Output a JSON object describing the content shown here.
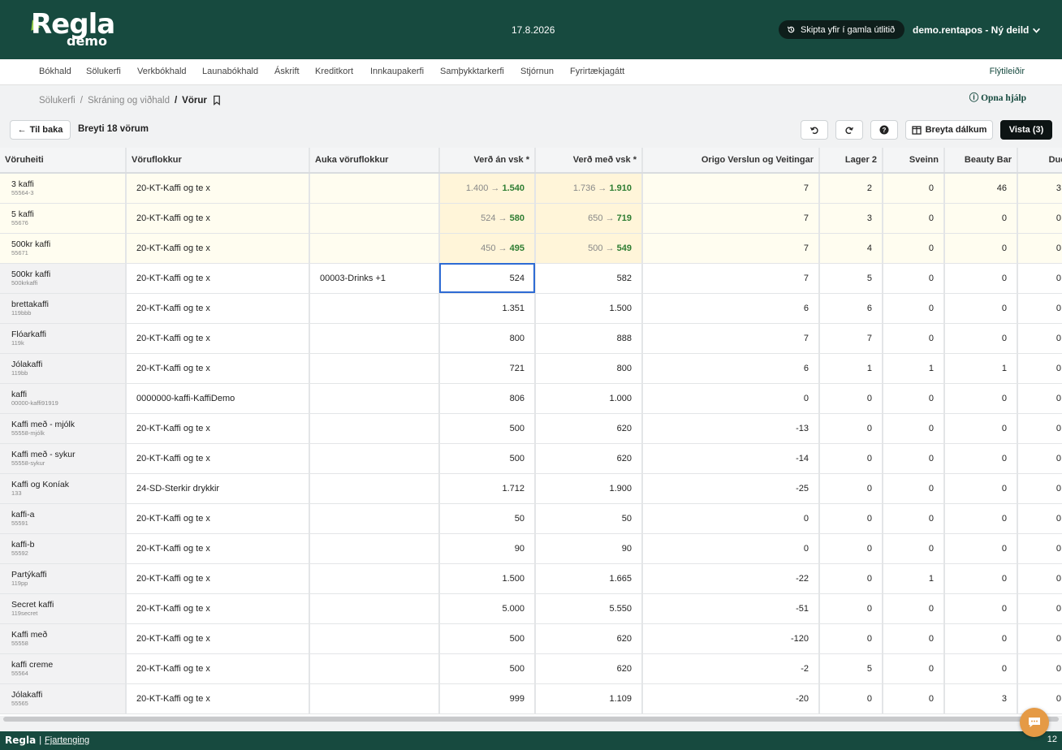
{
  "brand": {
    "logo": "Regla",
    "sub": "demo"
  },
  "header": {
    "date": "17.8.2026",
    "old_ui_label": "Skipta yfir í gamla útlitið",
    "user": "demo.rentapos - Ný deild"
  },
  "nav": {
    "items": [
      "Bókhald",
      "Sölukerfi",
      "Verkbókhald",
      "Launabókhald",
      "Áskrift",
      "Kreditkort",
      "Innkaupakerfi",
      "Samþykktarkerfi",
      "Stjórnun",
      "Fyrirtækjagátt"
    ],
    "shortcuts": "Flýtileiðir"
  },
  "breadcrumb": {
    "items": [
      "Sölukerfi",
      "Skráning og viðhald",
      "Vörur"
    ],
    "separator": "/",
    "help": "Opna hjálp"
  },
  "toolbar": {
    "back": "Til baka",
    "title": "Breyti 18 vörum",
    "columns": "Breyta dálkum",
    "save": "Vista (3)"
  },
  "table": {
    "headers": [
      "Vöruheiti",
      "Vöruflokkur",
      "Auka vöruflokkur",
      "Verð án vsk *",
      "Verð með vsk *",
      "Origo Verslun og Veitingar",
      "Lager 2",
      "Sveinn",
      "Beauty Bar",
      "Duo"
    ],
    "rows": [
      {
        "name": "3 kaffi",
        "sku": "55564-3",
        "cat": "20-KT-Kaffi og te x",
        "extra": "",
        "price_old": "1.400",
        "price_new": "1.540",
        "vat_old": "1.736",
        "vat_new": "1.910",
        "changed": true,
        "origo": "7",
        "lager2": "2",
        "sveinn": "0",
        "beauty": "46",
        "duo": "3"
      },
      {
        "name": "5 kaffi",
        "sku": "55676",
        "cat": "20-KT-Kaffi og te x",
        "extra": "",
        "price_old": "524",
        "price_new": "580",
        "vat_old": "650",
        "vat_new": "719",
        "changed": true,
        "origo": "7",
        "lager2": "3",
        "sveinn": "0",
        "beauty": "0",
        "duo": "0"
      },
      {
        "name": "500kr kaffi",
        "sku": "55671",
        "cat": "20-KT-Kaffi og te x",
        "extra": "",
        "price_old": "450",
        "price_new": "495",
        "vat_old": "500",
        "vat_new": "549",
        "changed": true,
        "origo": "7",
        "lager2": "4",
        "sveinn": "0",
        "beauty": "0",
        "duo": "0"
      },
      {
        "name": "500kr kaffi",
        "sku": "500krkaffi",
        "cat": "20-KT-Kaffi og te x",
        "extra": "00003-Drinks +1",
        "price": "524",
        "vat": "582",
        "origo": "7",
        "lager2": "5",
        "sveinn": "0",
        "beauty": "0",
        "duo": "0"
      },
      {
        "name": "brettakaffi",
        "sku": "119bbb",
        "cat": "20-KT-Kaffi og te x",
        "extra": "",
        "price": "1.351",
        "vat": "1.500",
        "origo": "6",
        "lager2": "6",
        "sveinn": "0",
        "beauty": "0",
        "duo": "0"
      },
      {
        "name": "Flóarkaffi",
        "sku": "119k",
        "cat": "20-KT-Kaffi og te x",
        "extra": "",
        "price": "800",
        "vat": "888",
        "origo": "7",
        "lager2": "7",
        "sveinn": "0",
        "beauty": "0",
        "duo": "0"
      },
      {
        "name": "Jólakaffi",
        "sku": "119bb",
        "cat": "20-KT-Kaffi og te x",
        "extra": "",
        "price": "721",
        "vat": "800",
        "origo": "6",
        "lager2": "1",
        "sveinn": "1",
        "beauty": "1",
        "duo": "0"
      },
      {
        "name": "kaffi",
        "sku": "00000-kaffi91919",
        "cat": "0000000-kaffi-KaffiDemo",
        "extra": "",
        "price": "806",
        "vat": "1.000",
        "origo": "0",
        "lager2": "0",
        "sveinn": "0",
        "beauty": "0",
        "duo": "0"
      },
      {
        "name": "Kaffi með - mjólk",
        "sku": "55558-mjólk",
        "cat": "20-KT-Kaffi og te x",
        "extra": "",
        "price": "500",
        "vat": "620",
        "origo": "-13",
        "lager2": "0",
        "sveinn": "0",
        "beauty": "0",
        "duo": "0"
      },
      {
        "name": "Kaffi með - sykur",
        "sku": "55558-sykur",
        "cat": "20-KT-Kaffi og te x",
        "extra": "",
        "price": "500",
        "vat": "620",
        "origo": "-14",
        "lager2": "0",
        "sveinn": "0",
        "beauty": "0",
        "duo": "0"
      },
      {
        "name": "Kaffi og Koníak",
        "sku": "133",
        "cat": "24-SD-Sterkir drykkir",
        "extra": "",
        "price": "1.712",
        "vat": "1.900",
        "origo": "-25",
        "lager2": "0",
        "sveinn": "0",
        "beauty": "0",
        "duo": "0"
      },
      {
        "name": "kaffi-a",
        "sku": "55591",
        "cat": "20-KT-Kaffi og te x",
        "extra": "",
        "price": "50",
        "vat": "50",
        "origo": "0",
        "lager2": "0",
        "sveinn": "0",
        "beauty": "0",
        "duo": "0"
      },
      {
        "name": "kaffi-b",
        "sku": "55592",
        "cat": "20-KT-Kaffi og te x",
        "extra": "",
        "price": "90",
        "vat": "90",
        "origo": "0",
        "lager2": "0",
        "sveinn": "0",
        "beauty": "0",
        "duo": "0"
      },
      {
        "name": "Partýkaffi",
        "sku": "119pp",
        "cat": "20-KT-Kaffi og te x",
        "extra": "",
        "price": "1.500",
        "vat": "1.665",
        "origo": "-22",
        "lager2": "0",
        "sveinn": "1",
        "beauty": "0",
        "duo": "0"
      },
      {
        "name": "Secret kaffi",
        "sku": "119secret",
        "cat": "20-KT-Kaffi og te x",
        "extra": "",
        "price": "5.000",
        "vat": "5.550",
        "origo": "-51",
        "lager2": "0",
        "sveinn": "0",
        "beauty": "0",
        "duo": "0"
      },
      {
        "name": "Kaffi með",
        "sku": "55558",
        "cat": "20-KT-Kaffi og te x",
        "extra": "",
        "price": "500",
        "vat": "620",
        "origo": "-120",
        "lager2": "0",
        "sveinn": "0",
        "beauty": "0",
        "duo": "0"
      },
      {
        "name": "kaffi creme",
        "sku": "55564",
        "cat": "20-KT-Kaffi og te x",
        "extra": "",
        "price": "500",
        "vat": "620",
        "origo": "-2",
        "lager2": "5",
        "sveinn": "0",
        "beauty": "0",
        "duo": "0"
      },
      {
        "name": "Jólakaffi",
        "sku": "55565",
        "cat": "20-KT-Kaffi og te x",
        "extra": "",
        "price": "999",
        "vat": "1.109",
        "origo": "-20",
        "lager2": "0",
        "sveinn": "0",
        "beauty": "3",
        "duo": "0"
      }
    ]
  },
  "footer": {
    "brand": "Regla",
    "link": "Fjartenging",
    "page": "12"
  },
  "colors": {
    "brand_green": "#174a3f",
    "changed_price": "#2e7d32",
    "selection": "#2e6bd4",
    "chat": "#e59a45"
  }
}
